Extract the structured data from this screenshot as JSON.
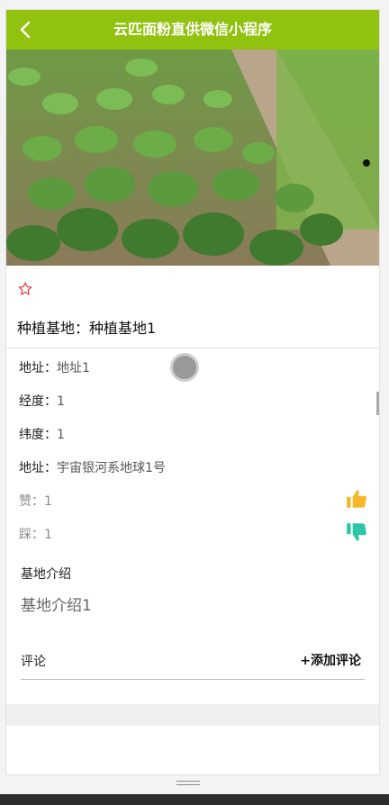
{
  "header": {
    "title": "云匹面粉直供微信小程序"
  },
  "base": {
    "title_label": "种植基地：",
    "title_value": "种植基地1"
  },
  "fields": [
    {
      "label": "地址：",
      "value": "地址1"
    },
    {
      "label": "经度：",
      "value": "1"
    },
    {
      "label": "纬度：",
      "value": "1"
    },
    {
      "label": "地址：",
      "value": "宇宙银河系地球1号"
    }
  ],
  "votes": {
    "like_label": "赞：",
    "like_count": "1",
    "dislike_label": "踩：",
    "dislike_count": "1"
  },
  "intro": {
    "heading": "基地介绍",
    "text": "基地介绍1"
  },
  "comments": {
    "heading": "评论",
    "add_label": "+添加评论"
  },
  "colors": {
    "nav": "#91c20f",
    "like": "#f5b82a",
    "dislike": "#2bc6a7",
    "favorite": "#e03c3c"
  },
  "icons": {
    "back": "chevron-left-icon",
    "favorite": "star-outline-icon",
    "like": "thumbs-up-icon",
    "dislike": "thumbs-down-icon"
  }
}
